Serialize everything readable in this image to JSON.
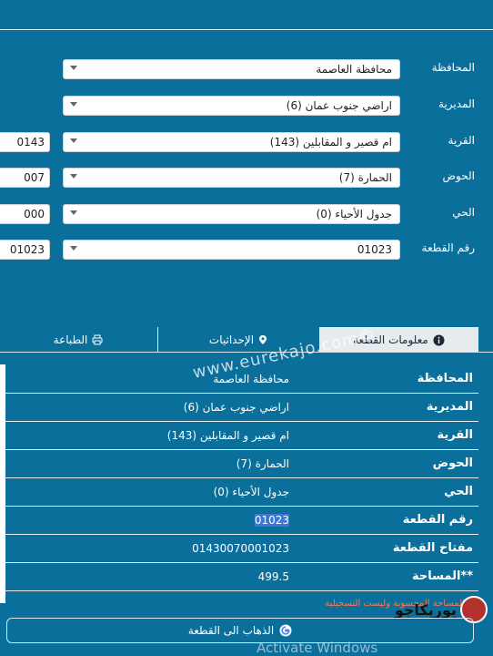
{
  "form": {
    "fields": [
      {
        "label": "المحافظة",
        "value": "محافظة العاصمة",
        "code": ""
      },
      {
        "label": "المديرية",
        "value": "اراضي جنوب عمان (6)",
        "code": ""
      },
      {
        "label": "القرية",
        "value": "ام قصير و المقابلين (143)",
        "code": "0143"
      },
      {
        "label": "الحوض",
        "value": "الحمارة (7)",
        "code": "007"
      },
      {
        "label": "الحي",
        "value": "جدول الأحياء (0)",
        "code": "000"
      },
      {
        "label": "رقم القطعة",
        "value": "01023",
        "code": "01023"
      }
    ]
  },
  "tabs": {
    "info": "معلومات القطعة",
    "coords": "الإحداثيات",
    "print": "الطباعة"
  },
  "details": [
    {
      "label": "المحافظة",
      "value": "محافظة العاصمة"
    },
    {
      "label": "المديرية",
      "value": "اراضي جنوب عمان (6)"
    },
    {
      "label": "القرية",
      "value": "ام قصير و المقابلين (143)"
    },
    {
      "label": "الحوض",
      "value": "الحمارة (7)"
    },
    {
      "label": "الحي",
      "value": "جدول الأحياء (0)"
    },
    {
      "label": "رقم القطعة",
      "value": "01023"
    },
    {
      "label": "مفتاح القطعة",
      "value": "01430070001023"
    },
    {
      "label": "**المساحة",
      "value": "499.5"
    }
  ],
  "note": "** المساحة المحسوبة وليست التسجيلية",
  "go_button": "الذهاب الى القطعة",
  "watermark": "www.eurekajo.com©",
  "activate_windows": "Activate Windows",
  "logo_text": "يوريكاجو",
  "colors": {
    "background": "#0b6f9c",
    "active_tab": "#e6ebee",
    "highlight": "#3b78d8",
    "note": "#f07a55"
  }
}
